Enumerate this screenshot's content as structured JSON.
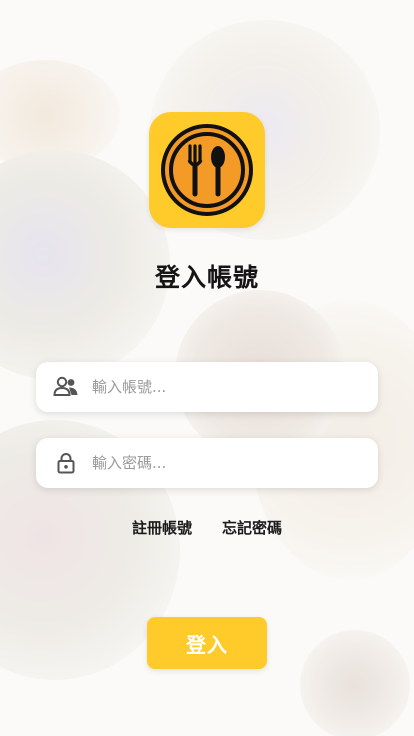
{
  "colors": {
    "accent": "#ffcb2b",
    "icon_inner": "#f39b26",
    "title": "#151515"
  },
  "logo": {
    "icon": "fork-spoon-plate-icon"
  },
  "page": {
    "title": "登入帳號"
  },
  "form": {
    "username": {
      "icon": "user-group-icon",
      "placeholder": "輸入帳號..."
    },
    "password": {
      "icon": "lock-icon",
      "placeholder": "輸入密碼..."
    }
  },
  "links": {
    "register": "註冊帳號",
    "forgot": "忘記密碼"
  },
  "actions": {
    "login": "登入"
  }
}
